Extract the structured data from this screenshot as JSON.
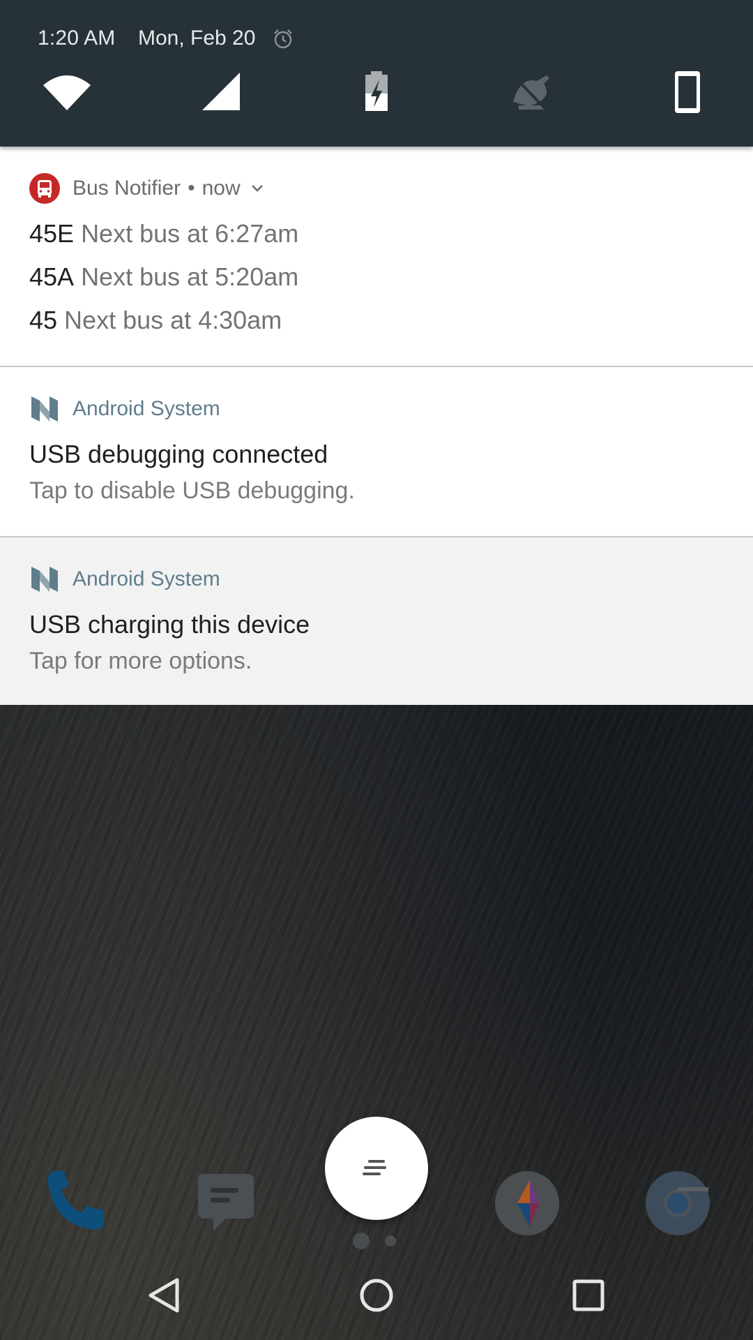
{
  "status": {
    "time": "1:20 AM",
    "date": "Mon, Feb 20",
    "icons": [
      "alarm-icon",
      "wifi-icon",
      "cellular-signal-icon",
      "battery-charging-icon",
      "do-not-disturb-off-icon",
      "phone-portrait-icon"
    ]
  },
  "notifications": [
    {
      "app": "Bus Notifier",
      "separator": "•",
      "time": "now",
      "accent": "#c62828",
      "lines": [
        {
          "route": "45E",
          "text": "Next bus at 6:27am"
        },
        {
          "route": "45A",
          "text": "Next bus at 5:20am"
        },
        {
          "route": "45",
          "text": "Next bus at 4:30am"
        }
      ]
    },
    {
      "app": "Android System",
      "title": "USB debugging connected",
      "text": "Tap to disable USB debugging."
    },
    {
      "app": "Android System",
      "title": "USB charging this device",
      "text": "Tap for more options."
    }
  ],
  "dock": {
    "apps": [
      "phone-icon",
      "messages-icon",
      "app-drawer-icon",
      "kotlin-app-icon",
      "chrome-icon"
    ]
  },
  "navigation": {
    "buttons": [
      "back-icon",
      "home-icon",
      "recents-icon"
    ]
  },
  "colors": {
    "header_bg": "#263238",
    "system_app_accent": "#5f7d8c",
    "bus_notifier_red": "#c62828"
  }
}
